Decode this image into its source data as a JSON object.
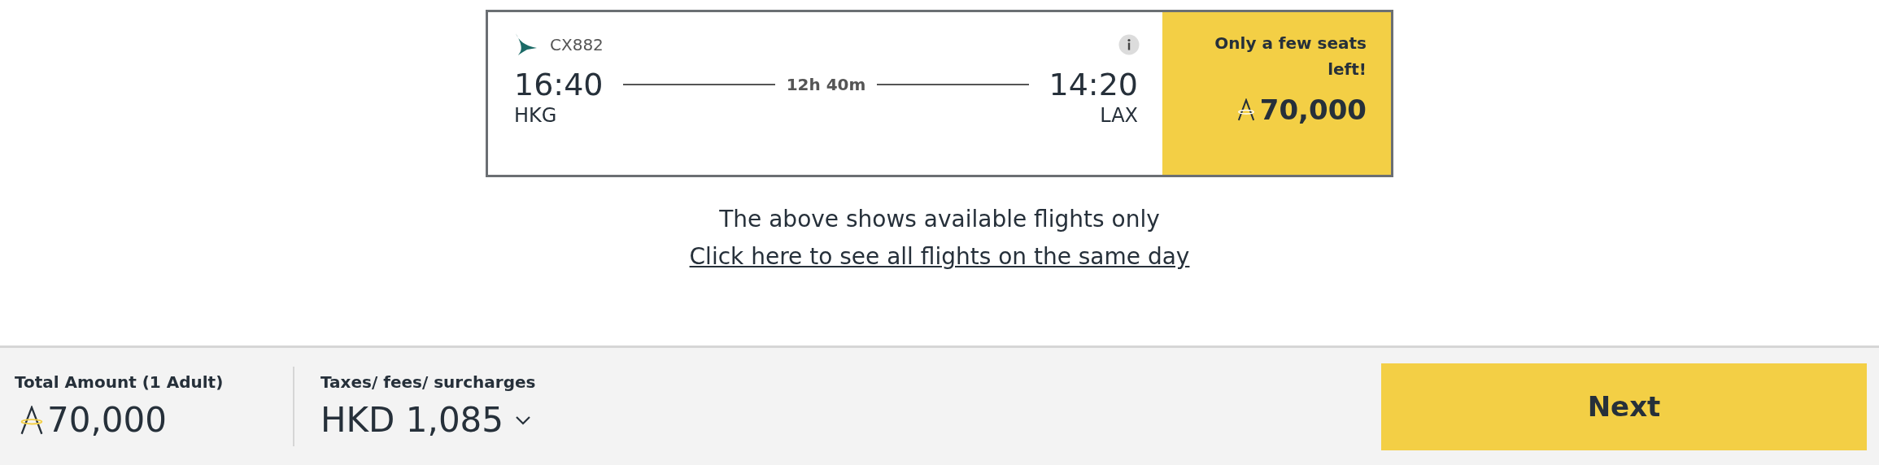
{
  "flight": {
    "flight_number": "CX882",
    "departure": {
      "time": "16:40",
      "airport": "HKG"
    },
    "duration": "12h 40m",
    "arrival": {
      "time": "14:20",
      "airport": "LAX"
    },
    "availability": "Only a few seats left!",
    "price": "70,000"
  },
  "notice": {
    "text": "The above shows available flights only",
    "link": "Click here to see all flights on the same day"
  },
  "footer": {
    "total_label": "Total Amount (1 Adult)",
    "total_value": "70,000",
    "taxes_label": "Taxes/ fees/ surcharges",
    "taxes_value": "HKD 1,085",
    "next_button": "Next"
  }
}
